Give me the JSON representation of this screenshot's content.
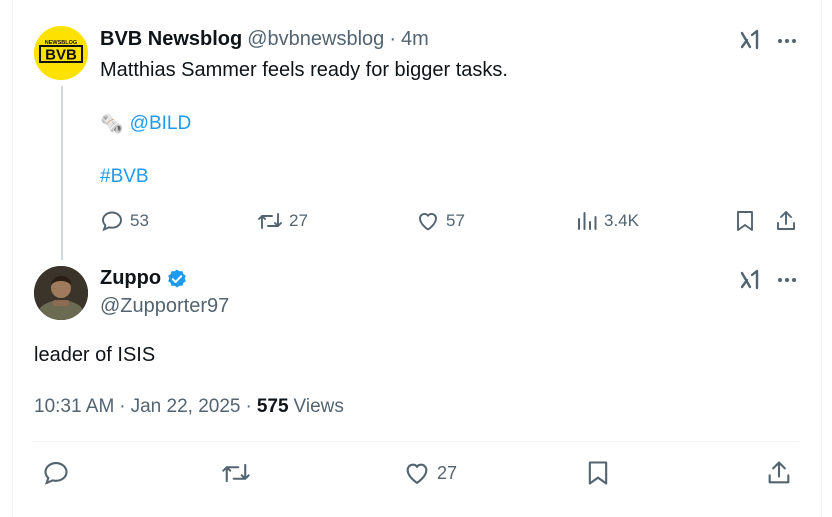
{
  "tweet1": {
    "author_name": "BVB Newsblog",
    "handle": "@bvbnewsblog",
    "separator": "·",
    "time": "4m",
    "text": "Matthias Sammer feels ready for bigger tasks.",
    "source_emoji": "🗞️",
    "source_mention": "@BILD",
    "hashtag": "#BVB",
    "avatar_logo_top": "NEWSBLOG",
    "avatar_logo_main": "BVB",
    "counts": {
      "replies": "53",
      "reposts": "27",
      "likes": "57",
      "views": "3.4K"
    }
  },
  "tweet2": {
    "author_name": "Zuppo",
    "handle": "@Zupporter97",
    "text": "leader of ISIS",
    "time": "10:31 AM",
    "dot1": "·",
    "date": "Jan 22, 2025",
    "dot2": "·",
    "views_count": "575",
    "views_label": "Views",
    "counts": {
      "likes": "27"
    }
  },
  "colors": {
    "accent": "#1d9bf0",
    "muted": "#536471",
    "verified": "#1d9bf0",
    "bvb_yellow": "#fde100"
  },
  "icons": [
    "grok-icon",
    "more-icon",
    "reply-icon",
    "repost-icon",
    "like-icon",
    "views-icon",
    "bookmark-icon",
    "share-icon",
    "verified-badge-icon",
    "newspaper-icon"
  ]
}
